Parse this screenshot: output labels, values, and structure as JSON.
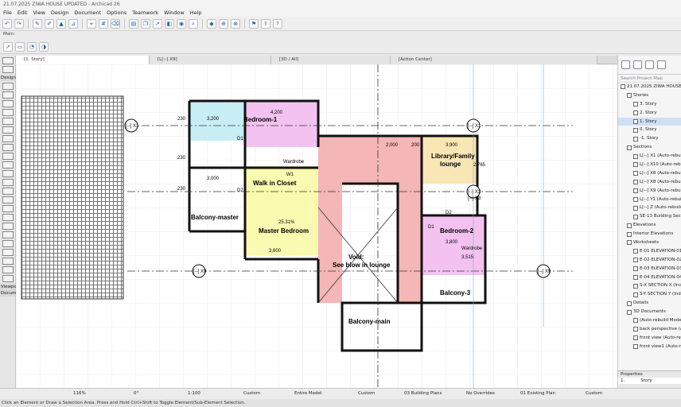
{
  "window": {
    "title": "21.07.2025 ZIWA HOUSE UPDATED - Archicad 26"
  },
  "menu": [
    "File",
    "Edit",
    "View",
    "Design",
    "Document",
    "Options",
    "Teamwork",
    "Window",
    "Help"
  ],
  "infobox": {
    "label": "Main:"
  },
  "tabs": [
    "[1. Story]",
    "[L[--] X9]",
    "[3D / All]",
    "[Action Center]"
  ],
  "toolbox": {
    "design_label": "Design",
    "viewpoint_label": "Viewpoi",
    "document_label": "Docume"
  },
  "plan": {
    "rooms": [
      "Bedroom-1",
      "Walk in Closet",
      "Balcony-master",
      "Master Bedroom",
      "Library/Family",
      "lounge",
      "Bedroom-2",
      "Balcony-3",
      "Balcony-main",
      "Void:",
      "See blow in lounge"
    ],
    "dims": [
      "4,200",
      "3,200",
      "3,000",
      "230",
      "230",
      "230",
      "200",
      "3,900",
      "3,800",
      "3,515",
      "3,600",
      "2,765",
      "25.31%",
      "D1",
      "D2",
      "D1",
      "D2",
      "W1",
      "2,000",
      "Wardrobe",
      "Wardrobe"
    ],
    "markers": [
      "[--] X1",
      "[--] X3",
      "[--] X9",
      "[--] X9",
      "[--] X1",
      "[--] X3"
    ]
  },
  "navigator": {
    "search_placeholder": "Search Project Map",
    "tree": [
      {
        "label": "21.07.2025 ZIWA HOUSE UPDATED",
        "indent": 0
      },
      {
        "label": "Stories",
        "indent": 1
      },
      {
        "label": "3. Story",
        "indent": 2
      },
      {
        "label": "2. Story",
        "indent": 2
      },
      {
        "label": "1. Story",
        "indent": 2,
        "selected": true
      },
      {
        "label": "0. Story",
        "indent": 2
      },
      {
        "label": "-1. Story",
        "indent": 2
      },
      {
        "label": "Sections",
        "indent": 1
      },
      {
        "label": "L[--] X1 (Auto-rebuild Model)",
        "indent": 2
      },
      {
        "label": "L[--] X10 (Auto-rebuild Model)",
        "indent": 2
      },
      {
        "label": "L[--] X8 (Auto-rebuild Model)",
        "indent": 2
      },
      {
        "label": "L[--] X8 (Auto-rebuild Model)",
        "indent": 2
      },
      {
        "label": "L[--] X9 (Auto-rebuild Model)",
        "indent": 2
      },
      {
        "label": "L[--] Y1 (Auto-rebuild Model)",
        "indent": 2
      },
      {
        "label": "L[--] Z (Auto-rebuild Model)",
        "indent": 2
      },
      {
        "label": "SE-13 Building Section",
        "indent": 2
      },
      {
        "label": "Elevations",
        "indent": 1
      },
      {
        "label": "Interior Elevations",
        "indent": 1
      },
      {
        "label": "Worksheets",
        "indent": 1
      },
      {
        "label": "E-01 ELEVATION-01",
        "indent": 2
      },
      {
        "label": "E-02 ELEVATION-02",
        "indent": 2
      },
      {
        "label": "E-03 ELEVATION-03",
        "indent": 2
      },
      {
        "label": "E-04 ELEVATION-04",
        "indent": 2
      },
      {
        "label": "S-X SECTION X (Independent)",
        "indent": 2
      },
      {
        "label": "S-Y SECTION Y (Independent)",
        "indent": 2
      },
      {
        "label": "Details",
        "indent": 1
      },
      {
        "label": "3D Documents",
        "indent": 1
      },
      {
        "label": "(Auto-rebuild Model)",
        "indent": 2
      },
      {
        "label": "back perspective (Auto-rebuild)",
        "indent": 2
      },
      {
        "label": "front view (Auto-rebuild)",
        "indent": 2
      },
      {
        "label": "front view1 (Auto-rebuild)",
        "indent": 2
      }
    ],
    "properties_label": "Properties",
    "prop_key": "1.",
    "prop_val": "Story"
  },
  "status": {
    "zoom": "116%",
    "angle": "0°",
    "scale": "1:100",
    "layer": "Custom",
    "model": "Entire Model",
    "pen": "Custom",
    "view": "03 Building Plans",
    "overrides": "No Overrides",
    "reno": "01 Existing Plan",
    "dim": "Custom"
  },
  "hint": "Click an Element or Draw a Selection Area. Press and Hold Ctrl+Shift to Toggle Element/Sub-Element Selection."
}
